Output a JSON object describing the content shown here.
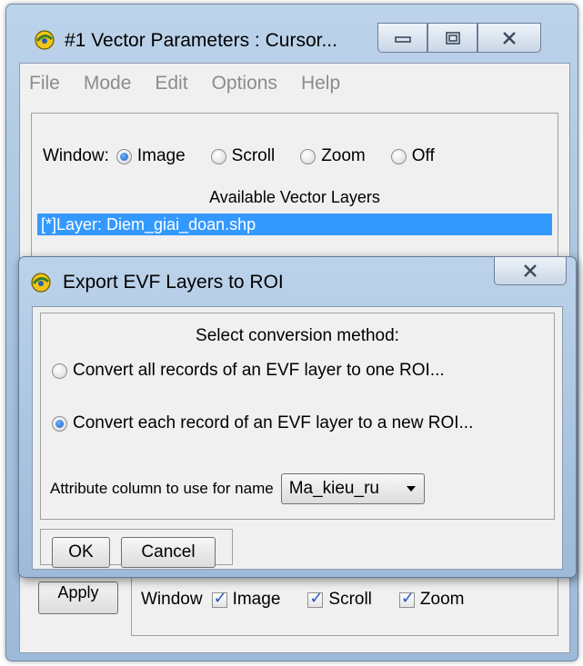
{
  "back_window": {
    "title": "#1 Vector Parameters : Cursor...",
    "menu": [
      "File",
      "Mode",
      "Edit",
      "Options",
      "Help"
    ],
    "window_label": "Window:",
    "window_options": [
      {
        "label": "Image",
        "selected": true
      },
      {
        "label": "Scroll",
        "selected": false
      },
      {
        "label": "Zoom",
        "selected": false
      },
      {
        "label": "Off",
        "selected": false
      }
    ],
    "available_layers_label": "Available Vector Layers",
    "selected_layer": "[*]Layer: Diem_giai_doan.shp",
    "apply_label": "Apply",
    "bottom_window_label": "Window",
    "bottom_checks": [
      {
        "label": "Image",
        "checked": true
      },
      {
        "label": "Scroll",
        "checked": true
      },
      {
        "label": "Zoom",
        "checked": true
      }
    ]
  },
  "dialog": {
    "title": "Export EVF Layers to ROI",
    "method_label": "Select conversion method:",
    "option_all": "Convert all records of an EVF layer to one ROI...",
    "option_each": "Convert each record of an EVF layer to a new ROI...",
    "selected_option": "each",
    "attribute_label": "Attribute column to use for name",
    "attribute_value": "Ma_kieu_ru",
    "ok_label": "OK",
    "cancel_label": "Cancel"
  },
  "colors": {
    "selection": "#3399ff",
    "frame": "#a9c4e0",
    "client": "#f0f0f0"
  }
}
